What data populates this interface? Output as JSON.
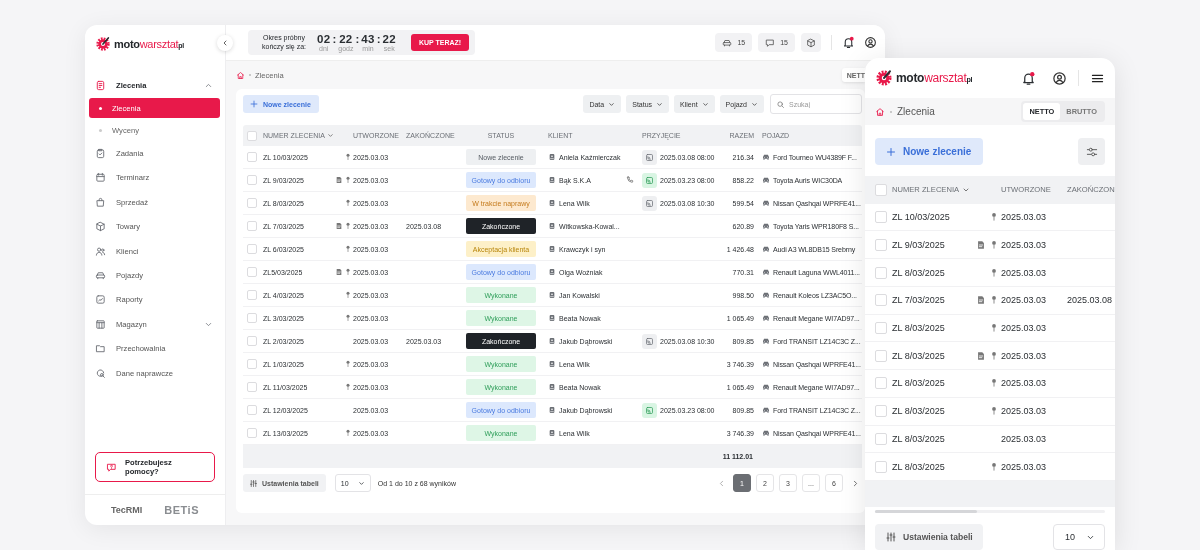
{
  "desktop": {
    "logo": {
      "first": "moto",
      "second": "warsztat",
      "suffix": "pl"
    },
    "sidebar": {
      "items": [
        {
          "label": "Zlecenia",
          "selected": true,
          "expanded": true,
          "children": [
            {
              "label": "Zlecenia",
              "selected": true
            },
            {
              "label": "Wyceny",
              "selected": false
            }
          ]
        },
        {
          "label": "Zadania",
          "selected": false
        },
        {
          "label": "Terminarz",
          "selected": false
        },
        {
          "label": "Sprzedaż",
          "selected": false
        },
        {
          "label": "Towary",
          "selected": false
        },
        {
          "label": "Klienci",
          "selected": false
        },
        {
          "label": "Pojazdy",
          "selected": false
        },
        {
          "label": "Raporty",
          "selected": false
        },
        {
          "label": "Magazyn",
          "selected": false,
          "expanded": false
        },
        {
          "label": "Przechowalnia",
          "selected": false
        },
        {
          "label": "Dane naprawcze",
          "selected": false
        }
      ],
      "help": "Potrzebujesz pomocy?",
      "partners": [
        "TecRMI",
        "BETiS"
      ]
    },
    "topbar": {
      "trial_label": "Okres próbny kończy się za:",
      "countdown": [
        {
          "value": "02",
          "unit": "dni"
        },
        {
          "separator": ":",
          "value": "22",
          "unit": "godz"
        },
        {
          "separator": ":",
          "value": "43",
          "unit": "min"
        },
        {
          "separator": ":",
          "value": "22",
          "unit": "sek"
        }
      ],
      "buy_button": "KUP TERAZ!",
      "counters": [
        "15",
        "15"
      ],
      "notifications": true
    },
    "breadcrumb": "Zlecenia",
    "price_toggle": "NETT",
    "toolbar": {
      "new_button": "Nowe zlecenie",
      "filters": [
        "Data",
        "Status",
        "Klient",
        "Pojazd"
      ],
      "search": {
        "placeholder": "Szukaj"
      }
    },
    "table": {
      "all_checked": false,
      "columns": [
        {
          "label": "NUMER ZLECENIA",
          "sorted": true
        },
        {
          "label": "UTWORZONE",
          "sorted": false
        },
        {
          "label": "ZAKOŃCZONE",
          "sorted": false
        },
        {
          "label": "STATUS",
          "sorted": false
        },
        {
          "label": "KLIENT",
          "sorted": false
        },
        {
          "label": "PRZYJĘCIE",
          "sorted": false
        },
        {
          "label": "RAZEM",
          "sorted": false
        },
        {
          "label": "POJAZD",
          "sorted": false
        }
      ],
      "rows": [
        {
          "number": "ZL 10/03/2025",
          "checked": false,
          "document": false,
          "pin": true,
          "created": "2025.03.03",
          "status": {
            "label": "Nowe zlecenie",
            "kind": "new"
          },
          "client": "Aniela Kaźmierczak",
          "phone": false,
          "arrival": {
            "time": "2025.03.08 08:00",
            "confirmed": false
          },
          "total": "216.34",
          "vehicle": "Ford Tourneo WU4389F F..."
        },
        {
          "number": "ZL 9/03/2025",
          "checked": false,
          "document": true,
          "pin": true,
          "created": "2025.03.03",
          "status": {
            "label": "Gotowy do odbioru",
            "kind": "ready"
          },
          "client": "Bąk S.K.A",
          "phone": true,
          "arrival": {
            "time": "2025.03.23 08:00",
            "confirmed": true
          },
          "total": "858.22",
          "vehicle": "Toyota Auris WIC30DA"
        },
        {
          "number": "ZL 8/03/2025",
          "checked": false,
          "document": false,
          "pin": true,
          "created": "2025.03.03",
          "status": {
            "label": "W trakcie naprawy",
            "kind": "repair"
          },
          "client": "Lena Wilk",
          "phone": false,
          "arrival": {
            "time": "2025.03.08 10:30",
            "confirmed": false
          },
          "total": "599.54",
          "vehicle": "Nissan Qashqai WPRFE41..."
        },
        {
          "number": "ZL 7/03/2025",
          "checked": false,
          "document": true,
          "pin": true,
          "created": "2025.03.03",
          "closed": "2025.03.08",
          "status": {
            "label": "Zakończone",
            "kind": "completed"
          },
          "client": "Witkowska-Kowal...",
          "phone": false,
          "total": "620.89",
          "vehicle": "Toyota Yaris WPR180F8 S..."
        },
        {
          "number": "ZL 6/03/2025",
          "checked": false,
          "document": false,
          "pin": true,
          "created": "2025.03.03",
          "status": {
            "label": "Akceptacja klienta",
            "kind": "accept"
          },
          "client": "Krawczyk i syn",
          "phone": false,
          "total": "1 426.48",
          "vehicle": "Audi A3 WL8DB15 Srebrny"
        },
        {
          "number": "ZL5/03/2025",
          "checked": false,
          "document": true,
          "pin": true,
          "created": "2025.03.03",
          "status": {
            "label": "Gotowy do odbioru",
            "kind": "ready"
          },
          "client": "Olga Woźniak",
          "phone": false,
          "total": "770.31",
          "vehicle": "Renault Laguna WWL4011..."
        },
        {
          "number": "ZL 4/03/2025",
          "checked": false,
          "document": false,
          "pin": true,
          "created": "2025.03.03",
          "status": {
            "label": "Wykonane",
            "kind": "done"
          },
          "client": "Jan Kowalski",
          "phone": false,
          "total": "998.50",
          "vehicle": "Renault Koleos LZ3AC5O..."
        },
        {
          "number": "ZL 3/03/2025",
          "checked": false,
          "document": false,
          "pin": true,
          "created": "2025.03.03",
          "status": {
            "label": "Wykonane",
            "kind": "done"
          },
          "client": "Beata Nowak",
          "phone": false,
          "total": "1 065.49",
          "vehicle": "Renault Megane WI7AD97..."
        },
        {
          "number": "ZL 2/03/2025",
          "checked": false,
          "document": false,
          "pin": false,
          "created": "2025.03.03",
          "closed": "2025.03.03",
          "status": {
            "label": "Zakończone",
            "kind": "completed"
          },
          "client": "Jakub Dąbrowski",
          "phone": false,
          "arrival": {
            "time": "2025.03.08 10:30",
            "confirmed": false
          },
          "total": "809.85",
          "vehicle": "Ford TRANSIT LZ14C3C Z..."
        },
        {
          "number": "ZL 1/03/2025",
          "checked": false,
          "document": false,
          "pin": true,
          "created": "2025.03.03",
          "status": {
            "label": "Wykonane",
            "kind": "done"
          },
          "client": "Lena Wilk",
          "phone": false,
          "total": "3 746.39",
          "vehicle": "Nissan Qashqai WPRFE41..."
        },
        {
          "number": "ZL 11/03/2025",
          "checked": false,
          "document": false,
          "pin": true,
          "created": "2025.03.03",
          "status": {
            "label": "Wykonane",
            "kind": "done"
          },
          "client": "Beata Nowak",
          "phone": false,
          "total": "1 065.49",
          "vehicle": "Renault Megane WI7AD97..."
        },
        {
          "number": "ZL 12/03/2025",
          "checked": false,
          "document": false,
          "pin": false,
          "created": "2025.03.03",
          "status": {
            "label": "Gotowy do odbioru",
            "kind": "ready"
          },
          "client": "Jakub Dąbrowski",
          "phone": false,
          "arrival": {
            "time": "2025.03.23 08:00",
            "confirmed": true
          },
          "total": "809.85",
          "vehicle": "Ford TRANSIT LZ14C3C Z..."
        },
        {
          "number": "ZL 13/03/2025",
          "checked": false,
          "document": false,
          "pin": true,
          "created": "2025.03.03",
          "status": {
            "label": "Wykonane",
            "kind": "done"
          },
          "client": "Lena Wilk",
          "phone": false,
          "total": "3 746.39",
          "vehicle": "Nissan Qashqai WPRFE41..."
        }
      ],
      "grand_total": "11 112.01"
    },
    "footer": {
      "settings_button": "Ustawienia tabeli",
      "page_size": "10",
      "summary": "Od 1 do 10 z 68 wyników",
      "pages": [
        {
          "label": "1",
          "selected": true
        },
        {
          "label": "2",
          "selected": false
        },
        {
          "label": "3",
          "selected": false
        },
        {
          "label": "...",
          "selected": false
        },
        {
          "label": "6",
          "selected": false
        }
      ]
    }
  },
  "mobile": {
    "logo": {
      "first": "moto",
      "second": "warsztat",
      "suffix": "pl"
    },
    "notifications": true,
    "breadcrumb": "Zlecenia",
    "price_toggle": [
      {
        "label": "NETTO",
        "selected": true
      },
      {
        "label": "BRUTTO",
        "selected": false
      }
    ],
    "new_button": "Nowe zlecenie",
    "table": {
      "all_checked": false,
      "columns": [
        {
          "label": "NUMER ZLECENIA",
          "sorted": true
        },
        {
          "label": "UTWORZONE",
          "sorted": false
        },
        {
          "label": "ZAKOŃCZON",
          "sorted": false
        }
      ],
      "rows": [
        {
          "number": "ZL 10/03/2025",
          "checked": false,
          "document": false,
          "pin": true,
          "created": "2025.03.03"
        },
        {
          "number": "ZL 9/03/2025",
          "checked": false,
          "document": true,
          "pin": true,
          "created": "2025.03.03"
        },
        {
          "number": "ZL 8/03/2025",
          "checked": false,
          "document": false,
          "pin": true,
          "created": "2025.03.03"
        },
        {
          "number": "ZL 7/03/2025",
          "checked": false,
          "document": true,
          "pin": true,
          "created": "2025.03.03",
          "closed": "2025.03.08"
        },
        {
          "number": "ZL 8/03/2025",
          "checked": false,
          "document": false,
          "pin": true,
          "created": "2025.03.03"
        },
        {
          "number": "ZL 8/03/2025",
          "checked": false,
          "document": true,
          "pin": true,
          "created": "2025.03.03"
        },
        {
          "number": "ZL 8/03/2025",
          "checked": false,
          "document": false,
          "pin": true,
          "created": "2025.03.03"
        },
        {
          "number": "ZL 8/03/2025",
          "checked": false,
          "document": false,
          "pin": true,
          "created": "2025.03.03"
        },
        {
          "number": "ZL 8/03/2025",
          "checked": false,
          "document": false,
          "pin": false,
          "created": "2025.03.03"
        },
        {
          "number": "ZL 8/03/2025",
          "checked": false,
          "document": false,
          "pin": true,
          "created": "2025.03.03"
        }
      ]
    },
    "settings_button": "Ustawienia tabeli",
    "page_size": "10"
  }
}
